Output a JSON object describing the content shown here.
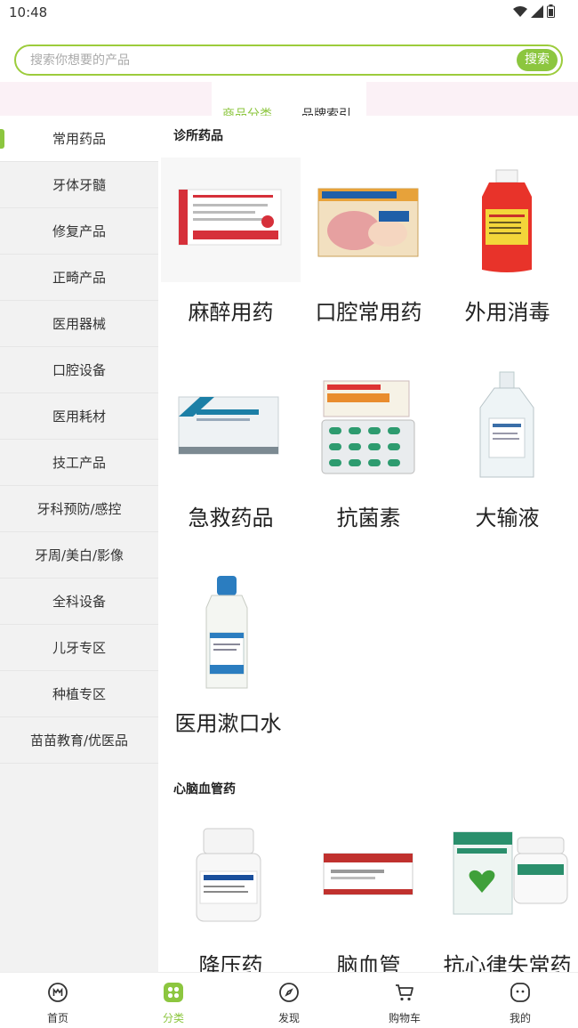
{
  "status": {
    "time": "10:48"
  },
  "search": {
    "placeholder": "搜索你想要的产品",
    "button_label": "搜索"
  },
  "top_tabs": {
    "category": "商品分类",
    "brand": "品牌索引"
  },
  "sidebar": {
    "items": [
      {
        "label": "常用药品"
      },
      {
        "label": "牙体牙髓"
      },
      {
        "label": "修复产品"
      },
      {
        "label": "正畸产品"
      },
      {
        "label": "医用器械"
      },
      {
        "label": "口腔设备"
      },
      {
        "label": "医用耗材"
      },
      {
        "label": "技工产品"
      },
      {
        "label": "牙科预防/感控"
      },
      {
        "label": "牙周/美白/影像"
      },
      {
        "label": "全科设备"
      },
      {
        "label": "儿牙专区"
      },
      {
        "label": "种植专区"
      },
      {
        "label": "苗苗教育/优医品"
      }
    ]
  },
  "sections": [
    {
      "title": "诊所药品",
      "items": [
        {
          "label": "麻醉用药",
          "image": "anesthetic-box"
        },
        {
          "label": "口腔常用药",
          "image": "oral-medicine-box"
        },
        {
          "label": "外用消毒",
          "image": "disinfectant-bottle"
        },
        {
          "label": "急救药品",
          "image": "emergency-box"
        },
        {
          "label": "抗菌素",
          "image": "antibiotic-capsules"
        },
        {
          "label": "大输液",
          "image": "infusion-bottle"
        },
        {
          "label": "医用漱口水",
          "image": "mouthwash-bottle"
        }
      ]
    },
    {
      "title": "心脑血管药",
      "items": [
        {
          "label": "降压药",
          "image": "pill-bottle"
        },
        {
          "label": "脑血管",
          "image": "medicine-box"
        },
        {
          "label": "抗心律失常药",
          "image": "heart-pills"
        }
      ]
    }
  ],
  "tabbar": {
    "items": [
      {
        "label": "首页",
        "icon": "home-icon"
      },
      {
        "label": "分类",
        "icon": "category-icon"
      },
      {
        "label": "发现",
        "icon": "discover-icon"
      },
      {
        "label": "购物车",
        "icon": "cart-icon"
      },
      {
        "label": "我的",
        "icon": "profile-icon"
      }
    ]
  },
  "colors": {
    "accent": "#8cc63f",
    "sidebar_bg": "#f2f2f2",
    "banner_pink": "#fbf1f6"
  }
}
